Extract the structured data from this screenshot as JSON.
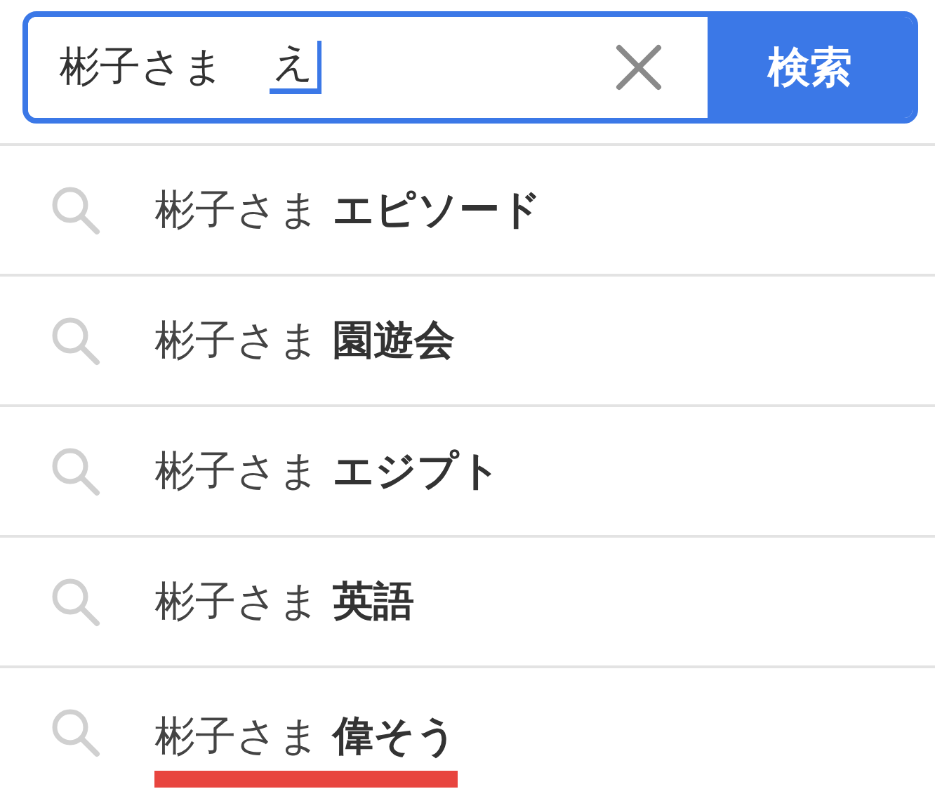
{
  "search": {
    "value": "彬子さま",
    "composing": "え",
    "button": "検索"
  },
  "suggestions": [
    {
      "text": "彬子さま **エピソード**",
      "underlined": false
    },
    {
      "text": "彬子さま **園遊会**",
      "underlined": false
    },
    {
      "text": "彬子さま **エジプト**",
      "underlined": false
    },
    {
      "text": "彬子さま **英語**",
      "underlined": false
    },
    {
      "text": "彬子さま **偉そう**",
      "underlined": true
    }
  ]
}
